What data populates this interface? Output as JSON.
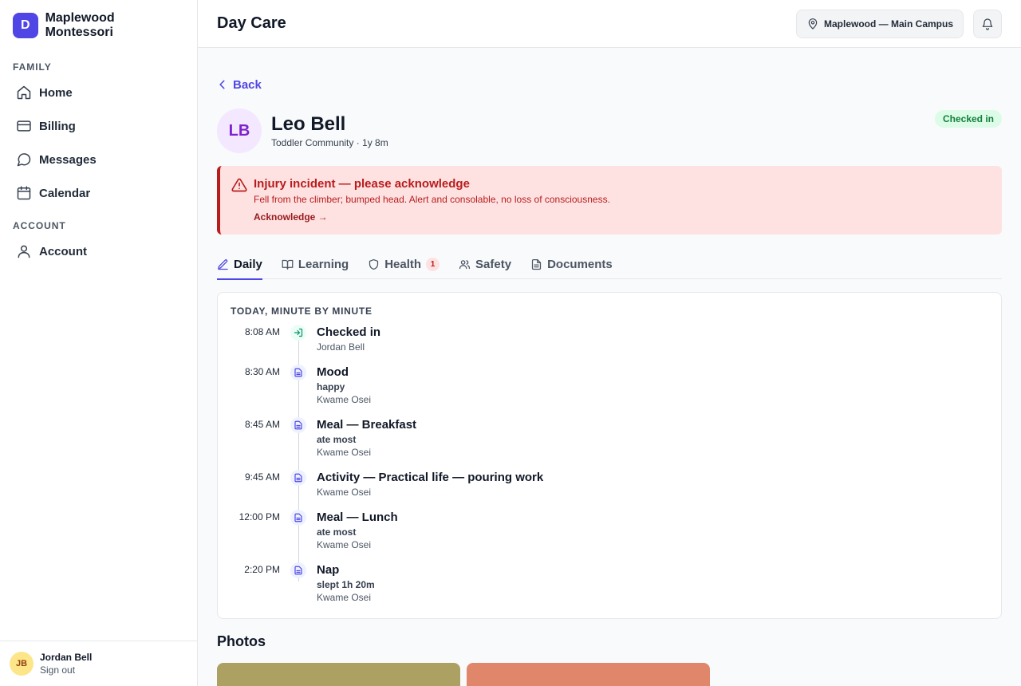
{
  "brand": {
    "logo_letter": "D",
    "name": "Maplewood Montessori",
    "accent": "#4f46e5"
  },
  "sidebar": {
    "family_label": "FAMILY",
    "family_items": [
      {
        "label": "Home",
        "icon": "home-icon"
      },
      {
        "label": "Billing",
        "icon": "credit-card-icon"
      },
      {
        "label": "Messages",
        "icon": "chat-bubble-icon"
      },
      {
        "label": "Calendar",
        "icon": "calendar-icon"
      }
    ],
    "account_label": "ACCOUNT",
    "account_items": [
      {
        "label": "Account",
        "icon": "user-icon"
      }
    ],
    "user": {
      "initials": "JB",
      "name": "Jordan Bell",
      "signout": "Sign out"
    }
  },
  "topbar": {
    "title": "Day Care",
    "campus": "Maplewood — Main Campus"
  },
  "page": {
    "back": "Back",
    "child": {
      "initials": "LB",
      "name": "Leo Bell",
      "subtitle": "Toddler Community · 1y 8m",
      "status": "Checked in"
    },
    "alert": {
      "title": "Injury incident — please acknowledge",
      "description": "Fell from the climber; bumped head. Alert and consolable, no loss of consciousness.",
      "action": "Acknowledge →"
    },
    "tabs": [
      {
        "label": "Daily",
        "icon": "pencil-icon",
        "active": true
      },
      {
        "label": "Learning",
        "icon": "book-icon"
      },
      {
        "label": "Health",
        "icon": "shield-icon",
        "count": "1"
      },
      {
        "label": "Safety",
        "icon": "users-icon"
      },
      {
        "label": "Documents",
        "icon": "document-icon"
      }
    ],
    "timeline": {
      "heading": "TODAY, MINUTE BY MINUTE",
      "events": [
        {
          "time": "8:08 AM",
          "title": "Checked in",
          "detail": "",
          "author": "Jordan Bell",
          "icon": "sign-in-icon"
        },
        {
          "time": "8:30 AM",
          "title": "Mood",
          "detail": "happy",
          "author": "Kwame Osei",
          "icon": "note-icon"
        },
        {
          "time": "8:45 AM",
          "title": "Meal — Breakfast",
          "detail": "ate most",
          "author": "Kwame Osei",
          "icon": "note-icon"
        },
        {
          "time": "9:45 AM",
          "title": "Activity — Practical life — pouring work",
          "detail": "",
          "author": "Kwame Osei",
          "icon": "note-icon"
        },
        {
          "time": "12:00 PM",
          "title": "Meal — Lunch",
          "detail": "ate most",
          "author": "Kwame Osei",
          "icon": "note-icon"
        },
        {
          "time": "2:20 PM",
          "title": "Nap",
          "detail": "slept 1h 20m",
          "author": "Kwame Osei",
          "icon": "note-icon"
        }
      ]
    },
    "photos": {
      "title": "Photos",
      "colors": [
        "#aca162",
        "#e0866a"
      ]
    }
  }
}
